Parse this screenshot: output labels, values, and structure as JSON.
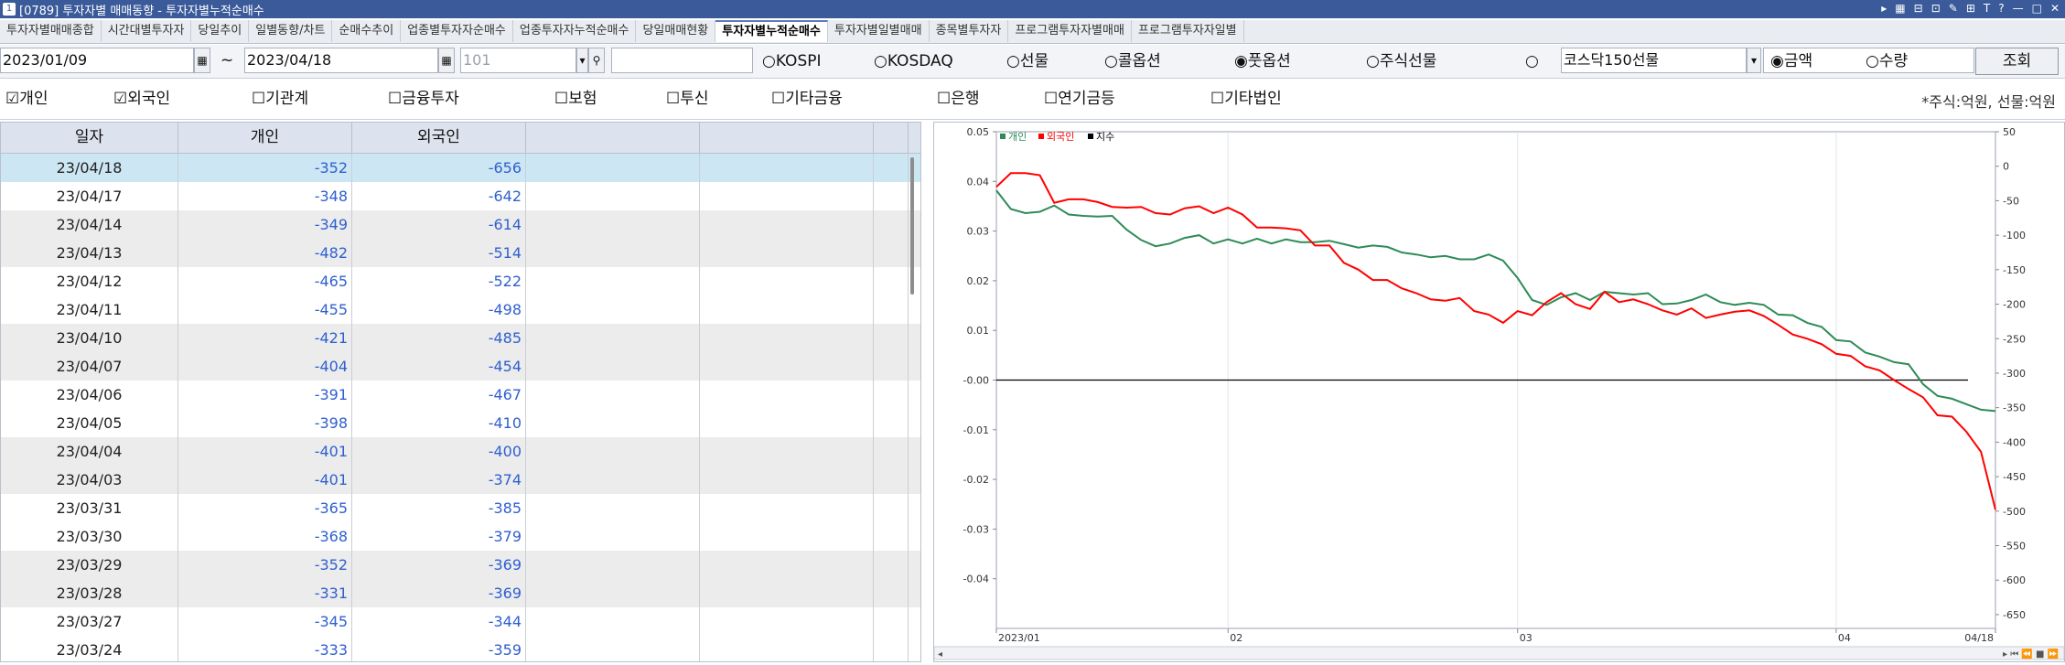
{
  "window": {
    "icon": "1",
    "title": "[0789] 투자자별 매매동향 - 투자자별누적순매수",
    "tool_icons": [
      "▸",
      "▦",
      "⊟",
      "⊡",
      "✎",
      "⊞",
      "T",
      "?",
      "—",
      "□",
      "✕"
    ]
  },
  "tabs": [
    "투자자별매매종합",
    "시간대별투자자",
    "당일추이",
    "일별동향/차트",
    "순매수추이",
    "업종별투자자순매수",
    "업종투자자누적순매수",
    "당일매매현황",
    "투자자별누적순매수",
    "투자자별일별매매",
    "종목별투자자",
    "프로그램투자자별매매",
    "프로그램투자자일별"
  ],
  "active_tab": 8,
  "filters": {
    "start_date": "2023/01/09",
    "tilde": "~",
    "end_date": "2023/04/18",
    "calendar_icon": "calendar-icon",
    "code_value": "101",
    "dropdown_icon": "▾",
    "search_icon": "⚲",
    "blank_value": "",
    "markets": [
      {
        "label": "KOSPI",
        "selected": false
      },
      {
        "label": "KOSDAQ",
        "selected": false
      },
      {
        "label": "선물",
        "selected": false
      },
      {
        "label": "콜옵션",
        "selected": false
      },
      {
        "label": "풋옵션",
        "selected": true
      },
      {
        "label": "주식선물",
        "selected": false
      },
      {
        "label": "",
        "selected": false
      }
    ],
    "product_select": "코스닥150선물",
    "units": [
      {
        "label": "금액",
        "selected": true
      },
      {
        "label": "수량",
        "selected": false
      }
    ],
    "query_button": "조회"
  },
  "investors": [
    {
      "label": "개인",
      "checked": true
    },
    {
      "label": "외국인",
      "checked": true
    },
    {
      "label": "기관계",
      "checked": false
    },
    {
      "label": "금융투자",
      "checked": false
    },
    {
      "label": "보험",
      "checked": false
    },
    {
      "label": "투신",
      "checked": false
    },
    {
      "label": "기타금융",
      "checked": false
    },
    {
      "label": "은행",
      "checked": false
    },
    {
      "label": "연기금등",
      "checked": false
    },
    {
      "label": "기타법인",
      "checked": false
    }
  ],
  "unit_note": "*주식:억원, 선물:억원",
  "table": {
    "headers": [
      "일자",
      "개인",
      "외국인",
      "",
      "",
      ""
    ],
    "rows": [
      [
        "23/04/18",
        "-352",
        "-656"
      ],
      [
        "23/04/17",
        "-348",
        "-642"
      ],
      [
        "23/04/14",
        "-349",
        "-614"
      ],
      [
        "23/04/13",
        "-482",
        "-514"
      ],
      [
        "23/04/12",
        "-465",
        "-522"
      ],
      [
        "23/04/11",
        "-455",
        "-498"
      ],
      [
        "23/04/10",
        "-421",
        "-485"
      ],
      [
        "23/04/07",
        "-404",
        "-454"
      ],
      [
        "23/04/06",
        "-391",
        "-467"
      ],
      [
        "23/04/05",
        "-398",
        "-410"
      ],
      [
        "23/04/04",
        "-401",
        "-400"
      ],
      [
        "23/04/03",
        "-401",
        "-374"
      ],
      [
        "23/03/31",
        "-365",
        "-385"
      ],
      [
        "23/03/30",
        "-368",
        "-379"
      ],
      [
        "23/03/29",
        "-352",
        "-369"
      ],
      [
        "23/03/28",
        "-331",
        "-369"
      ],
      [
        "23/03/27",
        "-345",
        "-344"
      ],
      [
        "23/03/24",
        "-333",
        "-359"
      ]
    ]
  },
  "chart_data": {
    "type": "line",
    "legend": [
      "개인",
      "외국인",
      "지수"
    ],
    "legend_placement": "top-left",
    "colors": {
      "개인": "#2e8b57",
      "외국인": "#ff0000",
      "지수": "#000000"
    },
    "left_axis": {
      "ylim": [
        -0.05,
        0.05
      ],
      "ticks": [
        "0.05",
        "0.04",
        "0.03",
        "0.02",
        "0.01",
        "-0.00",
        "-0.01",
        "-0.02",
        "-0.03",
        "-0.04"
      ]
    },
    "right_axis": {
      "ylim": [
        -670,
        50
      ],
      "ticks": [
        "50",
        "0",
        "-50",
        "-100",
        "-150",
        "-200",
        "-250",
        "-300",
        "-350",
        "-400",
        "-450",
        "-500",
        "-550",
        "-600",
        "-650"
      ]
    },
    "x_labels": [
      {
        "label": "2023/01",
        "index": 0
      },
      {
        "label": "02",
        "index": 16
      },
      {
        "label": "03",
        "index": 36
      },
      {
        "label": "04",
        "index": 58
      },
      {
        "label": "04/18",
        "index": 69
      }
    ],
    "grid": true,
    "series": [
      {
        "name": "개인",
        "axis": "right",
        "values": [
          -35,
          -62,
          -68,
          -66,
          -57,
          -70,
          -72,
          -73,
          -72,
          -92,
          -107,
          -116,
          -112,
          -104,
          -100,
          -112,
          -106,
          -112,
          -105,
          -112,
          -106,
          -110,
          -110,
          -108,
          -113,
          -118,
          -115,
          -117,
          -125,
          -128,
          -132,
          -130,
          -135,
          -135,
          -128,
          -137,
          -162,
          -194,
          -201,
          -190,
          -184,
          -194,
          -182,
          -184,
          -186,
          -184,
          -200,
          -199,
          -194,
          -186,
          -197,
          -201,
          -198,
          -201,
          -215,
          -216,
          -227,
          -233,
          -252,
          -254,
          -270,
          -276,
          -284,
          -287,
          -316,
          -333,
          -337,
          -345,
          -353,
          -355
        ]
      },
      {
        "name": "외국인",
        "axis": "right",
        "values": [
          -30,
          -10,
          -10,
          -13,
          -53,
          -48,
          -48,
          -52,
          -59,
          -60,
          -59,
          -68,
          -70,
          -61,
          -58,
          -68,
          -60,
          -70,
          -89,
          -89,
          -90,
          -93,
          -115,
          -115,
          -140,
          -150,
          -165,
          -165,
          -177,
          -184,
          -193,
          -195,
          -191,
          -210,
          -215,
          -227,
          -210,
          -216,
          -197,
          -184,
          -200,
          -207,
          -182,
          -197,
          -193,
          -200,
          -209,
          -215,
          -206,
          -220,
          -215,
          -211,
          -209,
          -217,
          -230,
          -244,
          -250,
          -258,
          -272,
          -275,
          -290,
          -296,
          -310,
          -323,
          -335,
          -361,
          -363,
          -385,
          -414,
          -498
        ]
      },
      {
        "name": "지수",
        "axis": "left",
        "values": [
          0.0,
          0.0
        ]
      }
    ]
  }
}
